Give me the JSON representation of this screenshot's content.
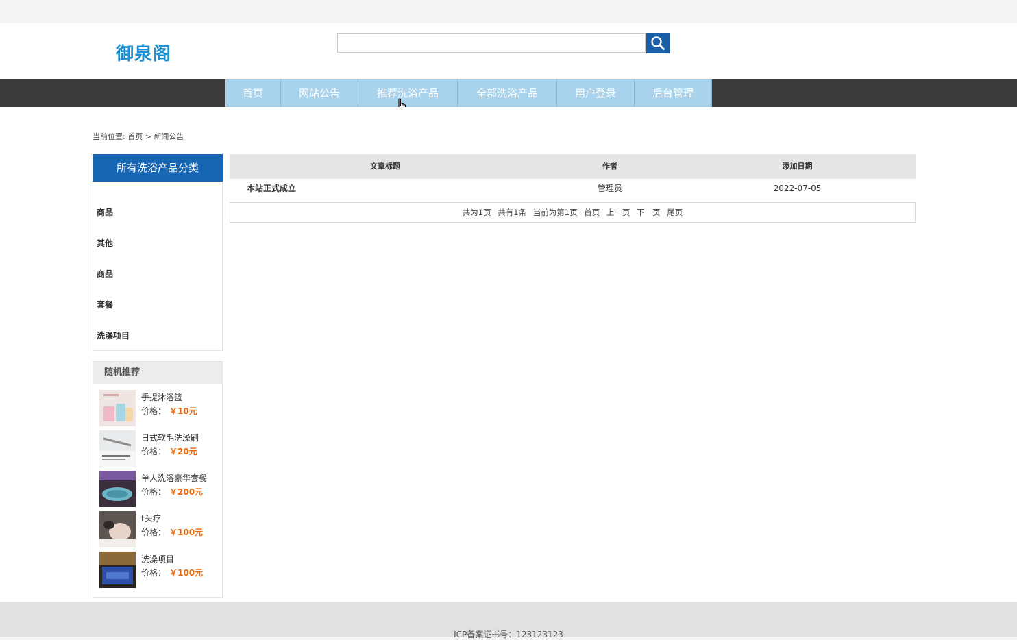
{
  "site": {
    "logo": "御泉阁"
  },
  "search": {
    "placeholder": "",
    "value": ""
  },
  "nav": {
    "items": [
      {
        "label": "首页",
        "name": "nav-home"
      },
      {
        "label": "网站公告",
        "name": "nav-announcements"
      },
      {
        "label": "推荐洗浴产品",
        "name": "nav-recommended"
      },
      {
        "label": "全部洗浴产品",
        "name": "nav-all-products"
      },
      {
        "label": "用户登录",
        "name": "nav-login"
      },
      {
        "label": "后台管理",
        "name": "nav-admin"
      }
    ]
  },
  "breadcrumb": {
    "prefix": "当前位置:",
    "home": "首页",
    "separator": ">",
    "current": "新闻公告"
  },
  "categories": {
    "title": "所有洗浴产品分类",
    "items": [
      "商品",
      "其他",
      "商品",
      "套餐",
      "洗澡项目"
    ]
  },
  "recommend": {
    "title": "随机推荐",
    "price_label": "价格：",
    "items": [
      {
        "name": "手提沐浴篮",
        "price": "￥10元",
        "thumb": "product-thumb-bath-basket"
      },
      {
        "name": "日式软毛洗澡刷",
        "price": "￥20元",
        "thumb": "product-thumb-bath-brush"
      },
      {
        "name": "单人洗浴豪华套餐",
        "price": "￥200元",
        "thumb": "product-thumb-luxury-bath-package"
      },
      {
        "name": "t头疗",
        "price": "￥100元",
        "thumb": "product-thumb-head-therapy"
      },
      {
        "name": "洗澡项目",
        "price": "￥100元",
        "thumb": "product-thumb-bath-project"
      }
    ]
  },
  "table": {
    "headers": {
      "title": "文章标题",
      "author": "作者",
      "date": "添加日期"
    },
    "rows": [
      {
        "title": "本站正式成立",
        "author": "管理员",
        "date": "2022-07-05"
      }
    ]
  },
  "pager": {
    "total_pages": "共为1页",
    "total_items": "共有1条",
    "current": "当前为第1页",
    "first": "首页",
    "prev": "上一页",
    "next": "下一页",
    "last": "尾页"
  },
  "footer": {
    "icp": "ICP备案证书号：123123123"
  },
  "colors": {
    "brand": "#1f8fcf",
    "nav_bg": "#3a3a3a",
    "nav_item": "#a9d3ec",
    "category_header": "#1766b4",
    "price": "#e86a0e"
  }
}
